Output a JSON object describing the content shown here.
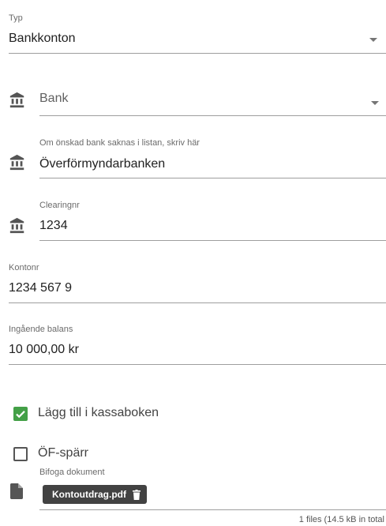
{
  "typ": {
    "label": "Typ",
    "value": "Bankkonton"
  },
  "bank": {
    "placeholder": "Bank"
  },
  "bank_other": {
    "label": "Om önskad bank saknas i listan, skriv här",
    "value": "Överförmyndarbanken"
  },
  "clearing": {
    "label": "Clearingnr",
    "value": "1234"
  },
  "kontonr": {
    "label": "Kontonr",
    "value": "1234 567 9"
  },
  "balans": {
    "label": "Ingående balans",
    "value": "10 000,00 kr"
  },
  "kassabok": {
    "label": "Lägg till i kassaboken",
    "checked": true
  },
  "ofsparr": {
    "label": "ÖF-spärr",
    "checked": false
  },
  "attachments": {
    "label": "Bifoga dokument",
    "files": [
      {
        "name": "Kontoutdrag.pdf"
      }
    ],
    "summary": "1 files (14.5 kB in total"
  },
  "colors": {
    "check_green": "#43a047",
    "chip_bg": "#424242"
  }
}
